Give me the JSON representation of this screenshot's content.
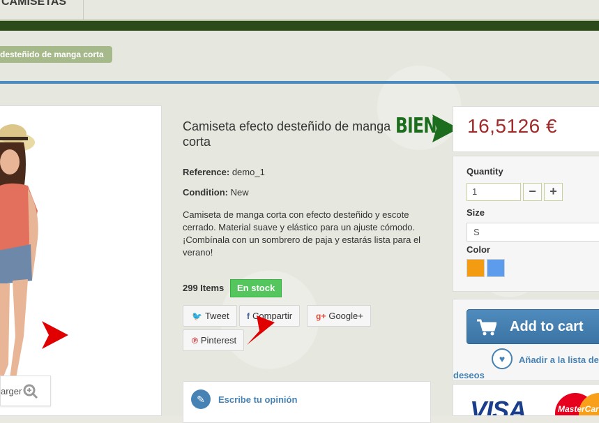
{
  "nav": {
    "menu_item": "CAMISETAS"
  },
  "breadcrumb": {
    "current": "desteñido de manga corta"
  },
  "image": {
    "enlarge_label": "arger"
  },
  "product": {
    "title": "Camiseta efecto desteñido de manga corta",
    "reference_label": "Reference:",
    "reference_value": "demo_1",
    "condition_label": "Condition:",
    "condition_value": "New",
    "description": "Camiseta de manga corta con efecto desteñido y escote cerrado. Material suave y elástico para un ajuste cómodo. ¡Combínala con un sombrero de paja y estarás lista para el verano!",
    "items_count": "299 Items",
    "stock_label": "En stock"
  },
  "share": {
    "tweet": "Tweet",
    "facebook": "Compartir",
    "google": "Google+",
    "pinterest": "Pinterest"
  },
  "review": {
    "label": "Escribe tu opinión"
  },
  "annotation": {
    "bien": "BIEN"
  },
  "price": {
    "value": "16,5126 €"
  },
  "options": {
    "quantity_label": "Quantity",
    "quantity_value": "1",
    "minus": "−",
    "plus": "+",
    "size_label": "Size",
    "size_value": "S",
    "color_label": "Color",
    "colors": [
      "#f39c11",
      "#5d9cec"
    ]
  },
  "cart": {
    "add_label": "Add to cart",
    "wishlist_line1": "Añadir a la lista de",
    "wishlist_line2": "deseos"
  },
  "payment": {
    "visa": "VISA",
    "mastercard": "MasterCard"
  },
  "colors": {
    "accent_blue": "#4682b4",
    "price_red": "#a12c2c",
    "stock_green": "#55c65e",
    "nav_dark": "#2d4a1b",
    "annotation_green": "#1d6d1f",
    "annotation_red": "#e00000"
  }
}
